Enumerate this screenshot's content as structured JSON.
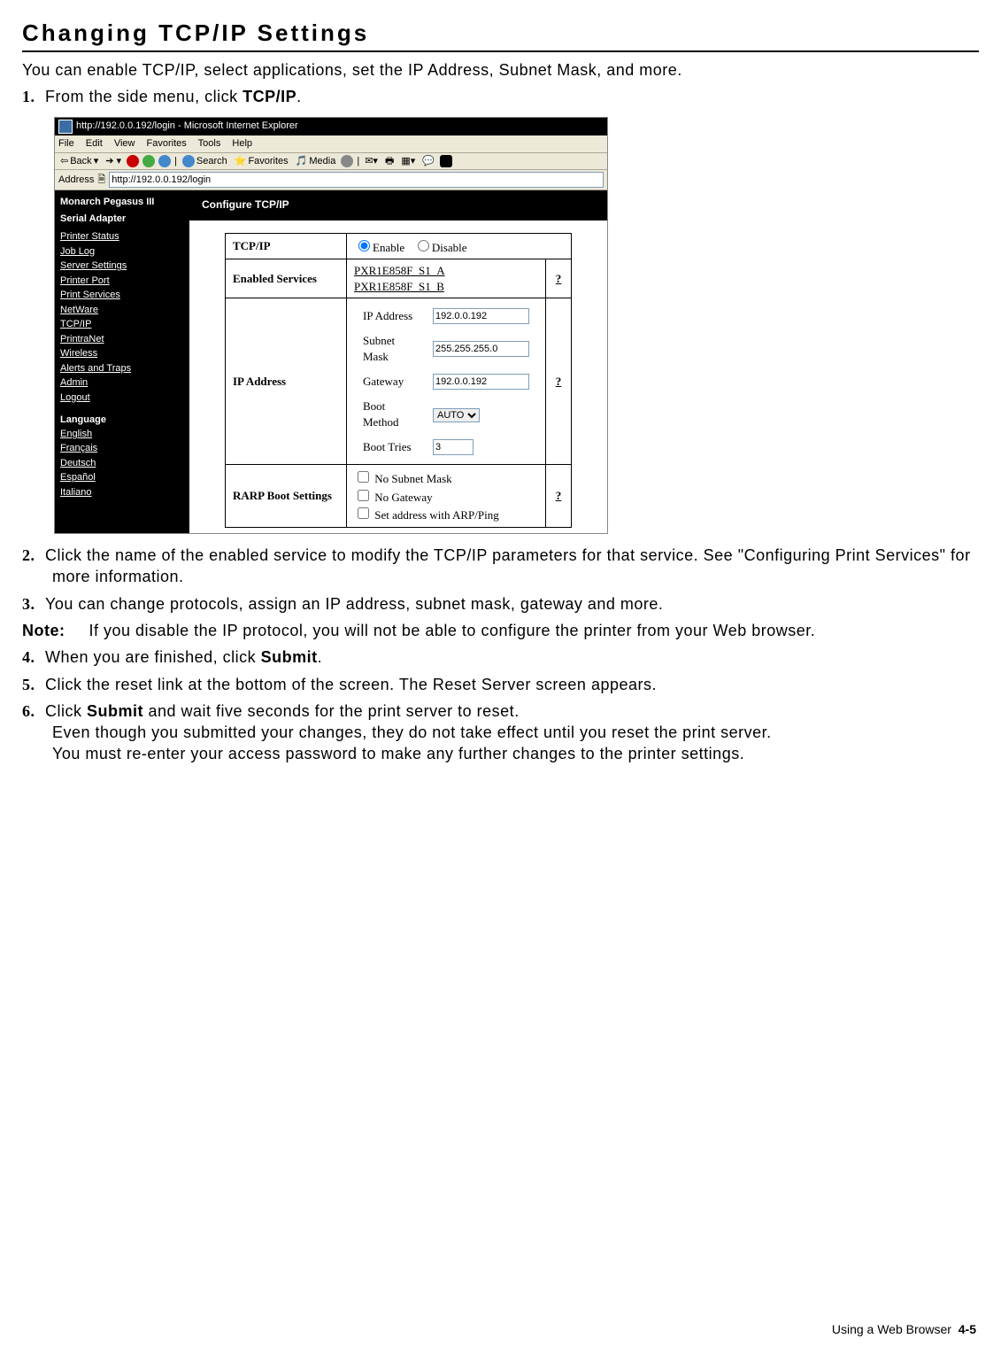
{
  "heading": "Changing TCP/IP Settings",
  "intro": "You can enable TCP/IP, select applications, set the IP Address, Subnet Mask, and more.",
  "steps": {
    "s1_num": "1.",
    "s1_a": "From the side menu, click ",
    "s1_b": "TCP/IP",
    "s1_c": ".",
    "s2_num": "2.",
    "s2": "Click the name of the enabled service to modify the TCP/IP parameters for that service. See \"Configuring Print Services\" for more information.",
    "s3_num": "3.",
    "s3": "You can change protocols, assign an IP address, subnet mask, gateway and more.",
    "s4_num": "4.",
    "s4_a": "When you are finished, click ",
    "s4_b": "Submit",
    "s4_c": ".",
    "s5_num": "5.",
    "s5": "Click the reset link at the bottom of the screen.  The Reset Server screen appears.",
    "s6_num": "6.",
    "s6_a": "Click ",
    "s6_b": "Submit",
    "s6_c": " and wait five seconds for the print server to reset.",
    "s6_line2": "Even though you submitted your changes, they do not take effect until you reset the print server.",
    "s6_line3": "You must re-enter your access password to make any further changes to the printer settings."
  },
  "note": {
    "label": "Note:",
    "body": "If you disable the IP protocol, you will not be able to configure the printer from your Web browser."
  },
  "ie": {
    "title": "http://192.0.0.192/login - Microsoft Internet Explorer",
    "menu": {
      "file": "File",
      "edit": "Edit",
      "view": "View",
      "favorites": "Favorites",
      "tools": "Tools",
      "help": "Help"
    },
    "toolbar": {
      "back": "Back",
      "search": "Search",
      "favorites": "Favorites",
      "media": "Media"
    },
    "addr_label": "Address",
    "addr_value": "http://192.0.0.192/login",
    "sidebar": {
      "title1": "Monarch Pegasus III",
      "title2": "Serial Adapter",
      "links": [
        "Printer Status",
        "Job Log",
        "Server Settings",
        "Printer Port",
        "Print Services",
        "NetWare",
        "TCP/IP",
        "PrintraNet",
        "Wireless",
        "Alerts and Traps",
        "Admin",
        "Logout"
      ],
      "lang_label": "Language",
      "langs": [
        "English",
        "Français",
        "Deutsch",
        "Español",
        "Italiano"
      ]
    },
    "main": {
      "heading": "Configure TCP/IP",
      "rows": {
        "tcpip_label": "TCP/IP",
        "enable": "Enable",
        "disable": "Disable",
        "enabled_services_label": "Enabled Services",
        "svc1": "PXR1E858F_S1_A",
        "svc2": "PXR1E858F_S1_B",
        "ipaddr_label": "IP Address",
        "ip_field": "IP Address",
        "ip_val": "192.0.0.192",
        "subnet_field": "Subnet Mask",
        "subnet_val": "255.255.255.0",
        "gateway_field": "Gateway",
        "gateway_val": "192.0.0.192",
        "boot_method_field": "Boot Method",
        "boot_method_val": "AUTO",
        "boot_tries_field": "Boot Tries",
        "boot_tries_val": "3",
        "rarp_label": "RARP Boot Settings",
        "rarp1": "No Subnet Mask",
        "rarp2": "No Gateway",
        "rarp3": "Set address with ARP/Ping",
        "help": "?"
      }
    }
  },
  "footer": {
    "text": "Using a Web Browser",
    "page": "4-5"
  }
}
